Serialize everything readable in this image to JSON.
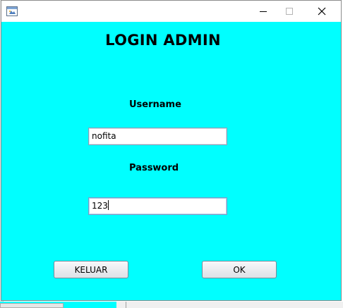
{
  "window": {
    "title": "",
    "app_icon": "java-window-icon",
    "controls": {
      "minimize": "minimize-icon",
      "maximize": "maximize-icon",
      "close": "close-icon"
    }
  },
  "form": {
    "heading": "LOGIN ADMIN",
    "username_label": "Username",
    "username_value": "nofita",
    "password_label": "Password",
    "password_value": "123",
    "exit_button": "KELUAR",
    "ok_button": "OK"
  },
  "colors": {
    "panel_background": "#00ffff",
    "titlebar": "#ffffff"
  }
}
